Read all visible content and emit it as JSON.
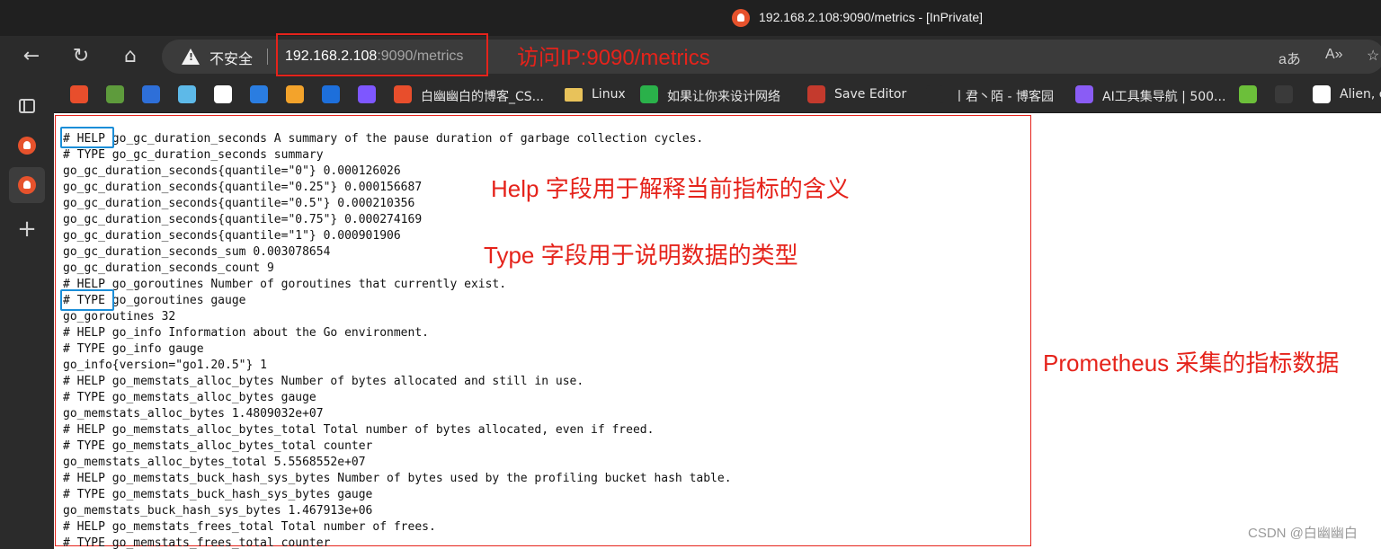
{
  "window": {
    "title": "192.168.2.108:9090/metrics - [InPrivate]"
  },
  "toolbar": {
    "security_label": "不安全",
    "url_host": "192.168.2.108",
    "url_rest": ":9090/metrics",
    "read_aloud_label": "aあ",
    "immersive_label": "A»"
  },
  "bookmarks": [
    {
      "label": "",
      "icon": "csdn-icon",
      "color": "#e84e2c"
    },
    {
      "label": "",
      "icon": "frog-icon",
      "color": "#5e9b3c"
    },
    {
      "label": "",
      "icon": "lines-icon",
      "color": "#2e6fd8"
    },
    {
      "label": "",
      "icon": "chart-icon",
      "color": "#5db9e8"
    },
    {
      "label": "",
      "icon": "g-icon",
      "color": "#ffffff"
    },
    {
      "label": "",
      "icon": "dsm-icon",
      "color": "#2a7de1"
    },
    {
      "label": "",
      "icon": "cube-icon",
      "color": "#f3a32b"
    },
    {
      "label": "",
      "icon": "on-icon",
      "color": "#1d6fdb"
    },
    {
      "label": "",
      "icon": "circle-c-icon",
      "color": "#7e57ff"
    },
    {
      "label": "白幽幽白的博客_CS...",
      "icon": "c-icon",
      "color": "#e84e2c"
    },
    {
      "label": "Linux",
      "icon": "folder-icon",
      "color": "#e8c25a"
    },
    {
      "label": "如果让你来设计网络",
      "icon": "wechat-icon",
      "color": "#2ab14a"
    },
    {
      "label": "Save Editor",
      "icon": "sword-icon",
      "color": "#c43a2d"
    },
    {
      "label": "丨君丶陌 - 博客园",
      "icon": "blank-icon",
      "color": "#2b2b2b"
    },
    {
      "label": "AI工具集导航 | 500...",
      "icon": "ai-icon",
      "color": "#8a5cf5"
    },
    {
      "label": "",
      "icon": "grid-icon",
      "color": "#6cbf3a"
    },
    {
      "label": "",
      "icon": "epic-icon",
      "color": "#3a3a3a"
    },
    {
      "label": "Alien, c",
      "icon": "alien-icon",
      "color": "#ffffff"
    }
  ],
  "metrics_lines": [
    "# HELP go_gc_duration_seconds A summary of the pause duration of garbage collection cycles.",
    "# TYPE go_gc_duration_seconds summary",
    "go_gc_duration_seconds{quantile=\"0\"} 0.000126026",
    "go_gc_duration_seconds{quantile=\"0.25\"} 0.000156687",
    "go_gc_duration_seconds{quantile=\"0.5\"} 0.000210356",
    "go_gc_duration_seconds{quantile=\"0.75\"} 0.000274169",
    "go_gc_duration_seconds{quantile=\"1\"} 0.000901906",
    "go_gc_duration_seconds_sum 0.003078654",
    "go_gc_duration_seconds_count 9",
    "# HELP go_goroutines Number of goroutines that currently exist.",
    "# TYPE go_goroutines gauge",
    "go_goroutines 32",
    "# HELP go_info Information about the Go environment.",
    "# TYPE go_info gauge",
    "go_info{version=\"go1.20.5\"} 1",
    "# HELP go_memstats_alloc_bytes Number of bytes allocated and still in use.",
    "# TYPE go_memstats_alloc_bytes gauge",
    "go_memstats_alloc_bytes 1.4809032e+07",
    "# HELP go_memstats_alloc_bytes_total Total number of bytes allocated, even if freed.",
    "# TYPE go_memstats_alloc_bytes_total counter",
    "go_memstats_alloc_bytes_total 5.5568552e+07",
    "# HELP go_memstats_buck_hash_sys_bytes Number of bytes used by the profiling bucket hash table.",
    "# TYPE go_memstats_buck_hash_sys_bytes gauge",
    "go_memstats_buck_hash_sys_bytes 1.467913e+06",
    "# HELP go_memstats_frees_total Total number of frees.",
    "# TYPE go_memstats_frees_total counter"
  ],
  "annotations": {
    "url_note": "访问IP:9090/metrics",
    "help_note": "Help 字段用于解释当前指标的含义",
    "type_note": "Type 字段用于说明数据的类型",
    "prometheus_note": "Prometheus 采集的指标数据"
  },
  "watermark": "CSDN @白幽幽白",
  "colors": {
    "annotation_red": "#e5231b",
    "highlight_blue": "#1b8ed8",
    "prometheus_orange": "#e6522c"
  }
}
